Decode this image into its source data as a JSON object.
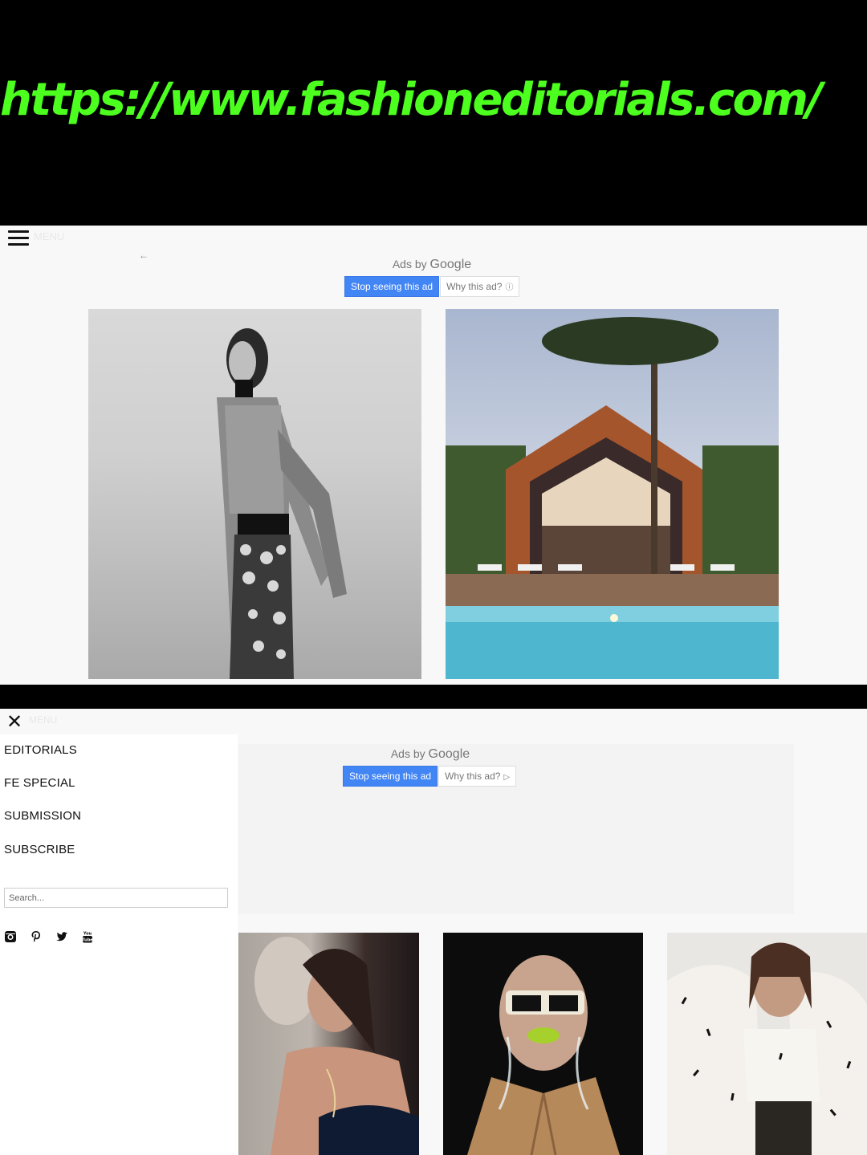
{
  "banner": {
    "url": "https://www.fashioneditorials.com/"
  },
  "screen1": {
    "menu_label": "MENU",
    "back_arrow": "←",
    "ads": {
      "ads_by": "Ads by",
      "google": "Google",
      "stop_label": "Stop seeing this ad",
      "why_label": "Why this ad?",
      "why_icon": "ⓘ"
    }
  },
  "screen2": {
    "menu_label": "MENU",
    "close_glyph": "✕",
    "ads": {
      "ads_by": "Ads by",
      "google": "Google",
      "stop_label": "Stop seeing this ad",
      "why_label": "Why this ad?",
      "why_icon": "▷"
    },
    "nav": [
      "EDITORIALS",
      "FE SPECIAL",
      "SUBMISSION",
      "SUBSCRIBE"
    ],
    "search_placeholder": "Search...",
    "social": [
      "instagram-icon",
      "pinterest-icon",
      "twitter-icon",
      "youtube-icon"
    ]
  },
  "colors": {
    "url_green": "#4cff1f",
    "google_blue": "#4285f4"
  }
}
